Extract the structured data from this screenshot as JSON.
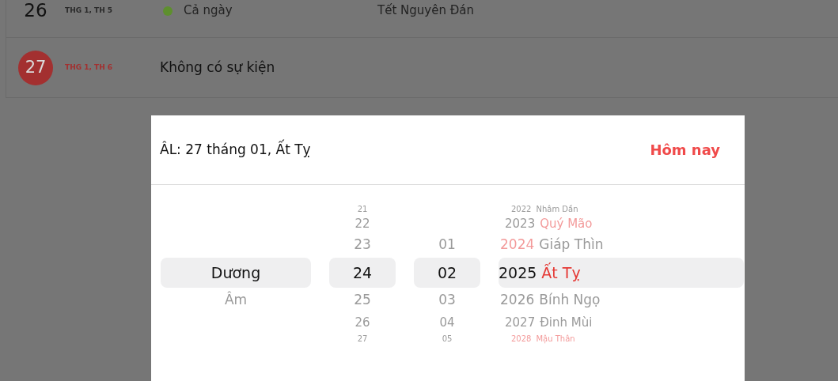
{
  "events": [
    {
      "day": "26",
      "weekday": "THG 1, TH 5",
      "today": false,
      "items": [
        {
          "time": "Cả ngày",
          "title": "Tết Nguyên Đán",
          "color": "#5e8f2e"
        }
      ]
    },
    {
      "day": "27",
      "weekday": "THG 1, TH 6",
      "today": true,
      "empty_text": "Không có sự kiện"
    }
  ],
  "picker": {
    "lunar_label": "ÂL: 27 tháng 01, Ất Tỵ",
    "today_button": "Hôm nay",
    "calendar_types": [
      {
        "label": "Dương",
        "selected": true
      },
      {
        "label": "Âm",
        "selected": false
      }
    ],
    "days": [
      {
        "label": "21",
        "selected": false
      },
      {
        "label": "22",
        "selected": false
      },
      {
        "label": "23",
        "selected": false
      },
      {
        "label": "24",
        "selected": true
      },
      {
        "label": "25",
        "selected": false
      },
      {
        "label": "26",
        "selected": false
      },
      {
        "label": "27",
        "selected": false
      }
    ],
    "months": [
      {
        "label": "01",
        "selected": false
      },
      {
        "label": "02",
        "selected": true
      },
      {
        "label": "03",
        "selected": false
      },
      {
        "label": "04",
        "selected": false
      },
      {
        "label": "05",
        "selected": false
      }
    ],
    "years": [
      {
        "year": "2022",
        "name": "Nhâm Dần",
        "year_highlight": false,
        "name_highlight": false,
        "selected": false
      },
      {
        "year": "2023",
        "name": "Quý Mão",
        "year_highlight": false,
        "name_highlight": true,
        "selected": false
      },
      {
        "year": "2024",
        "name": "Giáp Thìn",
        "year_highlight": true,
        "name_highlight": false,
        "selected": false
      },
      {
        "year": "2025",
        "name": "Ất Tỵ",
        "year_highlight": false,
        "name_highlight": true,
        "selected": true
      },
      {
        "year": "2026",
        "name": "Bính Ngọ",
        "year_highlight": false,
        "name_highlight": false,
        "selected": false
      },
      {
        "year": "2027",
        "name": "Đinh Mùi",
        "year_highlight": false,
        "name_highlight": false,
        "selected": false
      },
      {
        "year": "2028",
        "name": "Mậu Thân",
        "year_highlight": true,
        "name_highlight": true,
        "selected": false
      }
    ]
  }
}
